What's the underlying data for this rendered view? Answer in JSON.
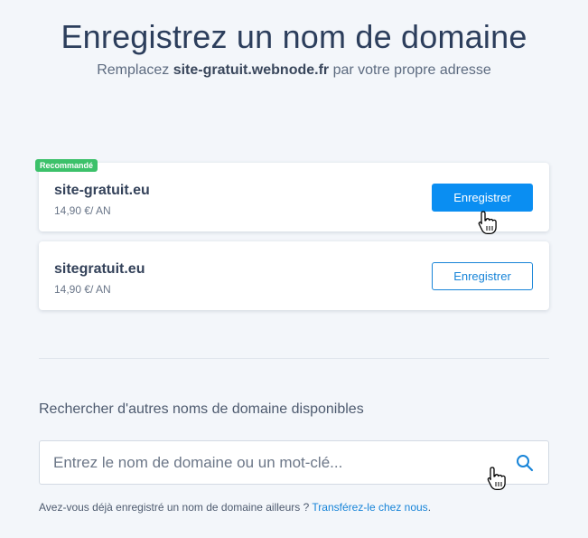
{
  "header": {
    "title": "Enregistrez un nom de domaine",
    "subtitle_prefix": "Remplacez ",
    "subtitle_domain": "site-gratuit.webnode.fr",
    "subtitle_suffix": " par votre propre adresse"
  },
  "domains": [
    {
      "badge": "Recommandé",
      "name": "site-gratuit.eu",
      "price": "14,90 €/ AN",
      "button_label": "Enregistrer"
    },
    {
      "name": "sitegratuit.eu",
      "price": "14,90 €/ AN",
      "button_label": "Enregistrer"
    }
  ],
  "search": {
    "label": "Rechercher d'autres noms de domaine disponibles",
    "placeholder": "Entrez le nom de domaine ou un mot-clé...",
    "icon": "search-icon"
  },
  "transfer": {
    "text": "Avez-vous déjà enregistré un nom de domaine ailleurs ? ",
    "link": "Transférez-le chez nous",
    "suffix": "."
  },
  "colors": {
    "primary": "#0a8ef2",
    "badge": "#3cc16a",
    "link": "#1784d8",
    "title": "#2c3e5c"
  }
}
